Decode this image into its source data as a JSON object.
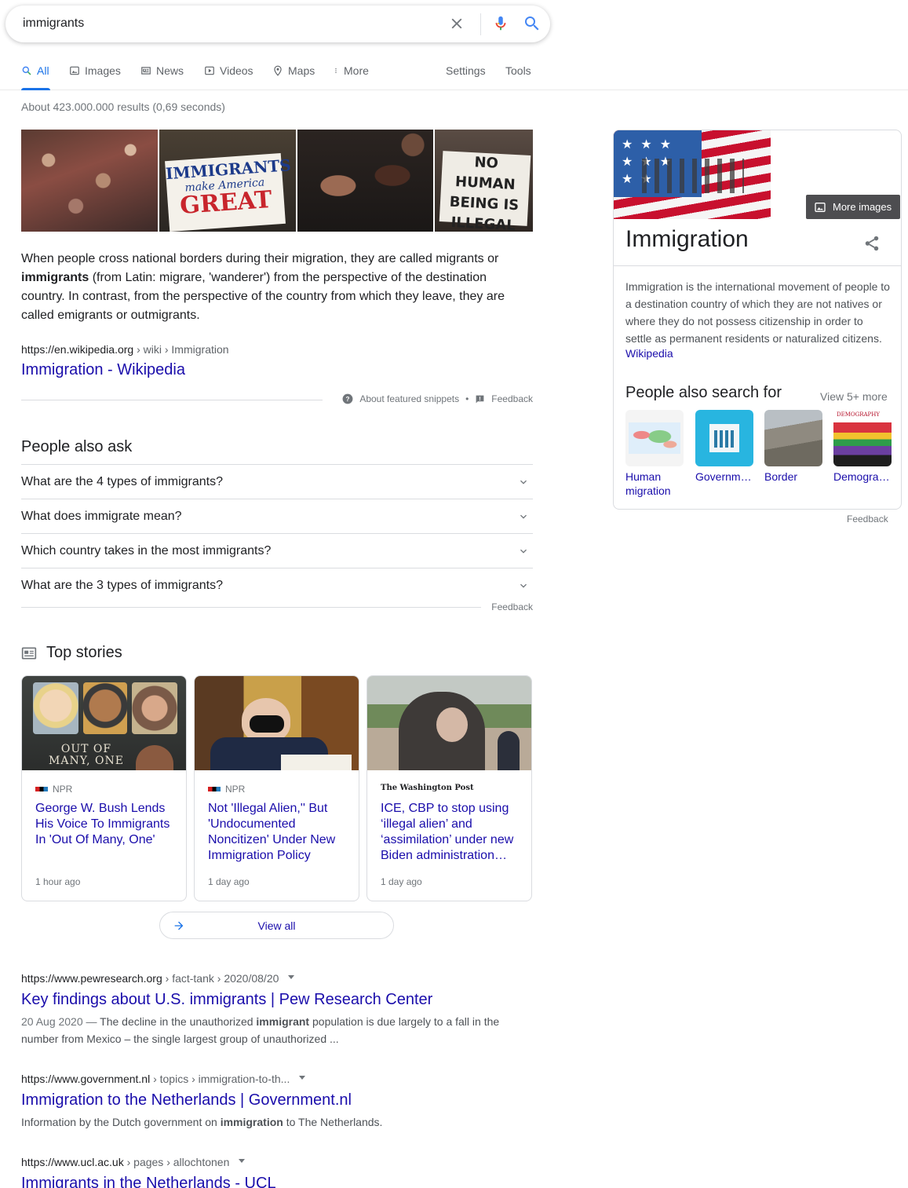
{
  "search": {
    "query": "immigrants",
    "clear_icon": "close-icon",
    "mic_icon": "microphone-icon",
    "search_icon": "search-icon"
  },
  "tabs": [
    {
      "label": "All",
      "icon": "search-icon",
      "active": true
    },
    {
      "label": "Images",
      "icon": "image-icon"
    },
    {
      "label": "News",
      "icon": "newspaper-icon"
    },
    {
      "label": "Videos",
      "icon": "play-icon"
    },
    {
      "label": "Maps",
      "icon": "map-pin-icon"
    },
    {
      "label": "More",
      "icon": "kebab-icon"
    }
  ],
  "tools": {
    "settings": "Settings",
    "tools": "Tools"
  },
  "stats": "About 423.000.000 results (0,69 seconds)",
  "featured": {
    "image_signs": [
      {
        "line1": "IMMIGRANTS",
        "line2": "make America",
        "line3": "GREAT"
      },
      {
        "line1": "NO HUMAN",
        "line2": "BEING IS",
        "line3": "ILLEGAL"
      }
    ],
    "snippet_pre": "When people cross national borders during their migration, they are called migrants or ",
    "snippet_bold": "immigrants",
    "snippet_post": " (from Latin: migrare, 'wanderer') from the perspective of the destination country. In contrast, from the perspective of the country from which they leave, they are called emigrants or outmigrants.",
    "url_domain": "https://en.wikipedia.org",
    "url_path": " › wiki › Immigration",
    "title": "Immigration - Wikipedia",
    "about": "About featured snippets",
    "dot": "•",
    "feedback": "Feedback"
  },
  "paa": {
    "title": "People also ask",
    "questions": [
      "What are the 4 types of immigrants?",
      "What does immigrate mean?",
      "Which country takes in the most immigrants?",
      "What are the 3 types of immigrants?"
    ],
    "feedback": "Feedback"
  },
  "top_stories": {
    "title": "Top stories",
    "stories": [
      {
        "source": "NPR",
        "headline": "George W. Bush Lends His Voice To Immigrants In 'Out Of Many, One'",
        "time": "1 hour ago",
        "image_text": "OUT OF MANY, ONE"
      },
      {
        "source": "NPR",
        "headline": "Not 'Illegal Alien,'' But 'Undocumented Noncitizen' Under New Immigration Policy",
        "time": "1 day ago"
      },
      {
        "source": "The Washington Post",
        "headline": "ICE, CBP to stop using ‘illegal alien’ and ‘assimilation’ under new Biden administration…",
        "time": "1 day ago"
      }
    ],
    "view_all": "View all"
  },
  "results": [
    {
      "domain": "https://www.pewresearch.org",
      "path": " › fact-tank › 2020/08/20",
      "title": "Key findings about U.S. immigrants | Pew Research Center",
      "date": "20 Aug 2020 — ",
      "desc_pre": "The decline in the unauthorized ",
      "desc_bold": "immigrant",
      "desc_post": " population is due largely to a fall in the number from Mexico – the single largest group of unauthorized ..."
    },
    {
      "domain": "https://www.government.nl",
      "path": " › topics › immigration-to-th...",
      "title": "Immigration to the Netherlands | Government.nl",
      "desc_pre": "Information by the Dutch government on ",
      "desc_bold": "immigration",
      "desc_post": " to The Netherlands."
    },
    {
      "domain": "https://www.ucl.ac.uk",
      "path": " › pages › allochtonen",
      "title": "Immigrants in the Netherlands - UCL"
    }
  ],
  "knowledge_panel": {
    "more_images": "More images",
    "title": "Immigration",
    "description": "Immigration is the international movement of people to a destination country of which they are not natives or where they do not possess citizenship in order to settle as permanent residents or naturalized citizens.",
    "source": "Wikipedia",
    "people_also_search": "People also search for",
    "view_more": "View 5+ more",
    "related": [
      {
        "label": "Human migration"
      },
      {
        "label": "Governm…"
      },
      {
        "label": "Border"
      },
      {
        "label": "Demogra…",
        "image_text": "DEMOGRAPHY"
      }
    ],
    "feedback": "Feedback"
  },
  "colors": {
    "link": "#1a0dab",
    "accent": "#1a73e8",
    "muted": "#70757a"
  }
}
